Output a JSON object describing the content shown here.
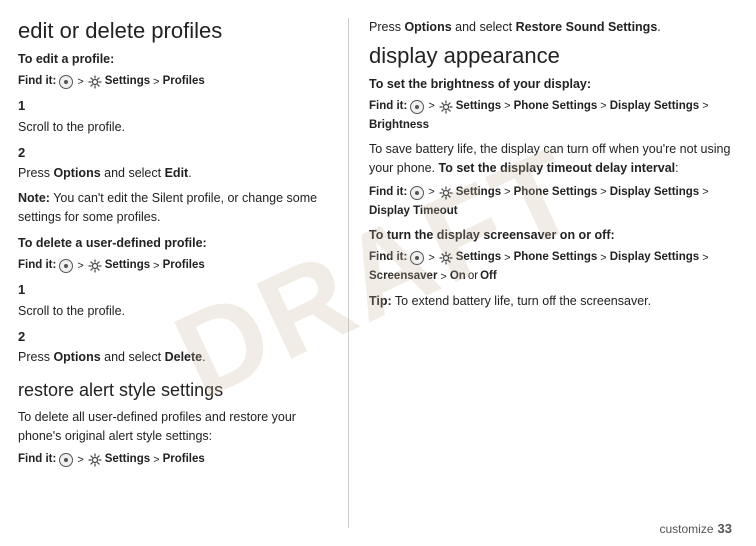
{
  "left": {
    "main_heading": "edit or delete profiles",
    "edit_label": "To edit a profile:",
    "edit_find_it": "Find it:",
    "edit_nav": [
      "Settings",
      "Profiles"
    ],
    "step1_num": "1",
    "step1_text": "Scroll to the profile.",
    "step2_num": "2",
    "step2_text": "Press Options and select Edit.",
    "note_prefix": "Note:",
    "note_text": " You can't edit the Silent profile, or change some settings for some profiles.",
    "delete_label": "To delete a user-defined profile:",
    "delete_find_it": "Find it:",
    "delete_nav": [
      "Settings",
      "Profiles"
    ],
    "step3_num": "1",
    "step3_text": "Scroll to the profile.",
    "step4_num": "2",
    "step4_text": "Press Options and select Delete.",
    "restore_heading": "restore alert style settings",
    "restore_para": "To delete all user-defined profiles and restore your phone's original alert style settings:",
    "restore_find_it": "Find it:",
    "restore_nav": [
      "Settings",
      "Profiles"
    ]
  },
  "right": {
    "restore_instructions": "Press Options and select Restore Sound Settings.",
    "display_heading": "display appearance",
    "brightness_label": "To set the brightness of your display:",
    "brightness_find_it": "Find it:",
    "brightness_nav": [
      "Settings",
      "Phone Settings",
      "Display Settings",
      "Brightness"
    ],
    "brightness_para": "To save battery life, the display can turn off when you're not using your phone. To set the display timeout delay interval:",
    "timeout_find_it": "Find it:",
    "timeout_nav": [
      "Settings",
      "Phone Settings",
      "Display Settings",
      "Display Timeout"
    ],
    "screensaver_label": "To turn the display screensaver on or off:",
    "screensaver_find_it": "Find it:",
    "screensaver_nav": [
      "Settings",
      "Phone Settings",
      "Display Settings",
      "Screensaver"
    ],
    "screensaver_options": "On or Off",
    "tip_prefix": "Tip:",
    "tip_text": " To extend battery life, turn off the screensaver."
  },
  "footer": {
    "word": "customize",
    "number": "33"
  },
  "draft_text": "DRAFT"
}
